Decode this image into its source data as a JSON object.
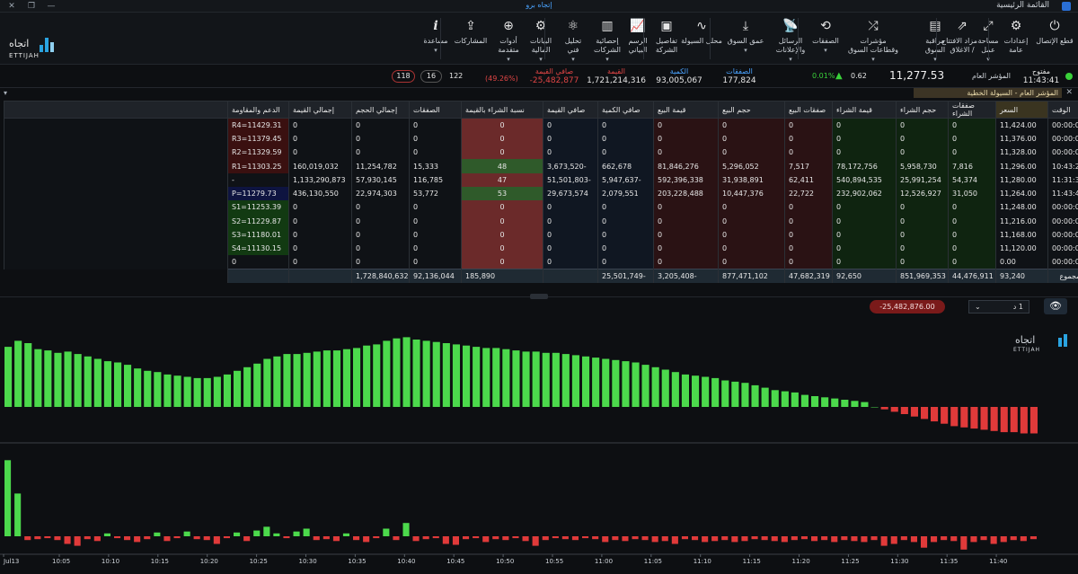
{
  "titlebar": {
    "title": "القائمة الرئيسية",
    "center": "إتجاه برو"
  },
  "ribbon": {
    "buttons": [
      {
        "label": "قطع الإتصال",
        "icon": "disconnect-icon",
        "glyph": "⏻"
      },
      {
        "label": "إعدادات",
        "label2": "عامة",
        "icon": "settings-icon",
        "glyph": "⚙"
      },
      {
        "label": "مساحة",
        "label2": "عمل",
        "dd": "▾",
        "icon": "workspace-icon",
        "glyph": "⤢"
      },
      {
        "label": "مزاد الافتتاح",
        "label2": "/ الاغلاق",
        "icon": "auction-icon",
        "glyph": "⇗"
      },
      {
        "label": "مراقبة",
        "label2": "السوق",
        "dd": "▾",
        "icon": "market-watch-icon",
        "glyph": "▤"
      },
      {
        "label": "مؤشرات",
        "label2": "وقطاعات السوق",
        "dd": "▾",
        "icon": "indices-icon",
        "glyph": "⤮"
      },
      {
        "label": "الصفقات",
        "dd": "▾",
        "icon": "trades-icon",
        "glyph": "⟲"
      },
      {
        "label": "الرسائل",
        "label2": "والإعلانات",
        "dd": "▾",
        "icon": "news-icon",
        "glyph": "📡"
      },
      {
        "label": "عمق السوق",
        "dd": "▾",
        "icon": "market-depth-icon",
        "glyph": "⤓"
      },
      {
        "label": "محلل السيولة",
        "icon": "liquidity-icon",
        "glyph": "∿"
      },
      {
        "label": "تفاصيل",
        "label2": "الشركة",
        "icon": "company-icon",
        "glyph": "▣"
      },
      {
        "label": "الرسم",
        "label2": "البياني",
        "icon": "chart-icon",
        "glyph": "📈"
      },
      {
        "label": "إحصائية",
        "label2": "الشركات",
        "dd": "▾",
        "icon": "stats-icon",
        "glyph": "▥"
      },
      {
        "label": "تحليل",
        "label2": "فني",
        "dd": "▾",
        "icon": "technical-icon",
        "glyph": "⚛"
      },
      {
        "label": "البيانات",
        "label2": "المالية",
        "dd": "▾",
        "icon": "financials-icon",
        "glyph": "⚙"
      },
      {
        "label": "أدوات",
        "label2": "متقدمة",
        "dd": "▾",
        "icon": "advanced-tools-icon",
        "glyph": "⊕"
      },
      {
        "label": "المشاركات",
        "icon": "share-icon",
        "glyph": "⇪"
      },
      {
        "label": "مساعدة",
        "dd": "▾",
        "icon": "help-icon",
        "glyph": "i"
      }
    ]
  },
  "logo": {
    "ar": "اتجاه",
    "en": "ETTIJAH"
  },
  "info": {
    "status": "مفتوح",
    "time": "11:43:41",
    "index_label": "المؤشر العام",
    "index_value": "11,277.53",
    "change": "0.62",
    "change_pct": "0.01%",
    "trades_label": "الصفقات",
    "trades_value": "177,824",
    "volume_label": "الكمية",
    "volume_value": "93,005,067",
    "value_label": "القيمة",
    "value_value": "1,721,214,316",
    "net_label": "صافي القيمة",
    "net_value": "-25,482,877",
    "net_pct": "(49.26%)",
    "up": "122",
    "unch": "16",
    "down": "118"
  },
  "panel": {
    "title": "المؤشر العام - السيولة الخطية"
  },
  "table": {
    "headers": [
      "الوقت",
      "السعر",
      "صفقات الشراء",
      "حجم الشراء",
      "قيمة الشراء",
      "صفقات البيع",
      "حجم البيع",
      "قيمة البيع",
      "صافي الكمية",
      "صافي القيمة",
      "نسبة الشراء بالقيمة",
      "الصفقات",
      "إجمالي الحجم",
      "إجمالي القيمة",
      "الدعم والمقاومة"
    ],
    "rows": [
      [
        "00:00:00",
        "11,424.00",
        "0",
        "0",
        "0",
        "0",
        "0",
        "0",
        "0",
        "0",
        "0",
        "0",
        "0",
        "0",
        "R4=11429.31"
      ],
      [
        "00:00:00",
        "11,376.00",
        "0",
        "0",
        "0",
        "0",
        "0",
        "0",
        "0",
        "0",
        "0",
        "0",
        "0",
        "0",
        "R3=11379.45"
      ],
      [
        "00:00:00",
        "11,328.00",
        "0",
        "0",
        "0",
        "0",
        "0",
        "0",
        "0",
        "0",
        "0",
        "0",
        "0",
        "0",
        "R2=11329.59"
      ],
      [
        "10:43:22",
        "11,296.00",
        "7,816",
        "5,958,730",
        "78,172,756",
        "7,517",
        "5,296,052",
        "81,846,276",
        "662,678",
        "-3,673,520",
        "48",
        "15,333",
        "11,254,782",
        "160,019,032",
        "R1=11303.25"
      ],
      [
        "11:31:31",
        "11,280.00",
        "54,374",
        "25,991,254",
        "540,894,535",
        "62,411",
        "31,938,891",
        "592,396,338",
        "-5,947,637",
        "-51,501,803",
        "47",
        "116,785",
        "57,930,145",
        "1,133,290,873",
        "-"
      ],
      [
        "11:43:40",
        "11,264.00",
        "31,050",
        "12,526,927",
        "232,902,062",
        "22,722",
        "10,447,376",
        "203,228,488",
        "2,079,551",
        "29,673,574",
        "53",
        "53,772",
        "22,974,303",
        "436,130,550",
        "P=11279.73"
      ],
      [
        "00:00:00",
        "11,248.00",
        "0",
        "0",
        "0",
        "0",
        "0",
        "0",
        "0",
        "0",
        "0",
        "0",
        "0",
        "0",
        "S1=11253.39"
      ],
      [
        "00:00:00",
        "11,216.00",
        "0",
        "0",
        "0",
        "0",
        "0",
        "0",
        "0",
        "0",
        "0",
        "0",
        "0",
        "0",
        "S2=11229.87"
      ],
      [
        "00:00:00",
        "11,168.00",
        "0",
        "0",
        "0",
        "0",
        "0",
        "0",
        "0",
        "0",
        "0",
        "0",
        "0",
        "0",
        "S3=11180.01"
      ],
      [
        "00:00:00",
        "11,120.00",
        "0",
        "0",
        "0",
        "0",
        "0",
        "0",
        "0",
        "0",
        "0",
        "0",
        "0",
        "0",
        "S4=11130.15"
      ],
      [
        "00:00:00",
        "0.00",
        "0",
        "0",
        "0",
        "0",
        "0",
        "0",
        "0",
        "0",
        "0",
        "0",
        "0",
        "0",
        "0"
      ]
    ],
    "total": [
      "المجموع",
      "93,240",
      "44,476,911",
      "851,969,353",
      "92,650",
      "47,682,319",
      "877,471,102",
      "-3,205,408",
      "-25,501,749",
      "",
      "185,890",
      "92,136,044",
      "1,728,840,632",
      ""
    ]
  },
  "controls": {
    "net_value": "-25,482,876.00",
    "period": "1 د"
  },
  "colors": {
    "up": "#4cd94c",
    "down": "#e03a3a",
    "accent": "#2aa3e0"
  },
  "chart_data": [
    {
      "type": "bar",
      "x": [
        "10:00",
        "10:01",
        "10:02",
        "10:03",
        "10:04",
        "10:05",
        "10:06",
        "10:07",
        "10:08",
        "10:09",
        "10:10",
        "10:11",
        "10:12",
        "10:13",
        "10:14",
        "10:15",
        "10:16",
        "10:17",
        "10:18",
        "10:19",
        "10:20",
        "10:21",
        "10:22",
        "10:23",
        "10:24",
        "10:25",
        "10:26",
        "10:27",
        "10:28",
        "10:29",
        "10:30",
        "10:31",
        "10:32",
        "10:33",
        "10:34",
        "10:35",
        "10:36",
        "10:37",
        "10:38",
        "10:39",
        "10:40",
        "10:41",
        "10:42",
        "10:43",
        "10:44",
        "10:45",
        "10:46",
        "10:47",
        "10:48",
        "10:49",
        "10:50",
        "10:51",
        "10:52",
        "10:53",
        "10:54",
        "10:55",
        "10:56",
        "10:57",
        "10:58",
        "10:59",
        "11:00",
        "11:01",
        "11:02",
        "11:03",
        "11:04",
        "11:05",
        "11:06",
        "11:07",
        "11:08",
        "11:09",
        "11:10",
        "11:11",
        "11:12",
        "11:13",
        "11:14",
        "11:15",
        "11:16",
        "11:17",
        "11:18",
        "11:19",
        "11:20",
        "11:21",
        "11:22",
        "11:23",
        "11:24",
        "11:25",
        "11:26",
        "11:27",
        "11:28",
        "11:29",
        "11:30",
        "11:31",
        "11:32",
        "11:33",
        "11:34",
        "11:35",
        "11:36",
        "11:37",
        "11:38",
        "11:39",
        "11:40",
        "11:41",
        "11:42",
        "11:43"
      ],
      "series": [
        {
          "values": [
            50,
            55,
            53,
            48,
            47,
            45,
            46,
            44,
            42,
            40,
            38,
            37,
            35,
            32,
            30,
            29,
            27,
            26,
            25,
            24,
            24,
            25,
            27,
            30,
            33,
            36,
            40,
            42,
            44,
            44,
            45,
            46,
            47,
            47,
            48,
            49,
            51,
            52,
            55,
            57,
            58,
            56,
            55,
            54,
            53,
            52,
            51,
            50,
            49,
            49,
            48,
            47,
            46,
            46,
            45,
            45,
            44,
            43,
            42,
            41,
            40,
            39,
            38,
            37,
            35,
            33,
            31,
            29,
            27,
            26,
            25,
            24,
            22,
            21,
            20,
            18,
            16,
            14,
            13,
            12,
            10,
            9,
            8,
            7,
            6,
            5,
            4,
            0,
            -2,
            -4,
            -6,
            -8,
            -10,
            -12,
            -14,
            -16,
            -17,
            -18,
            -19,
            -20,
            -21,
            -21,
            -22,
            -22
          ]
        }
      ],
      "ylim": [
        -30,
        62
      ]
    },
    {
      "type": "bar",
      "x_ticks": [
        "Jul13",
        "10:05",
        "10:10",
        "10:15",
        "10:20",
        "10:25",
        "10:30",
        "10:35",
        "10:40",
        "10:45",
        "10:50",
        "10:55",
        "11:00",
        "11:05",
        "11:10",
        "11:15",
        "11:20",
        "11:25",
        "11:30",
        "11:35",
        "11:40"
      ],
      "series": [
        {
          "values": [
            80,
            45,
            -4,
            -3,
            -2,
            -4,
            -8,
            -10,
            -3,
            -5,
            3,
            -2,
            -4,
            -6,
            -3,
            4,
            -5,
            -2,
            5,
            -3,
            -4,
            -8,
            -2,
            4,
            -5,
            6,
            10,
            3,
            -2,
            5,
            8,
            -4,
            -3,
            -5,
            3,
            -4,
            -6,
            -2,
            8,
            -4,
            14,
            -5,
            -3,
            -2,
            -8,
            -9,
            -3,
            -2,
            -6,
            -3,
            -4,
            -2,
            -5,
            -10,
            -4,
            -2,
            -3,
            -4,
            -2,
            -3,
            -6,
            -4,
            -5,
            -3,
            -4,
            -6,
            -5,
            -8,
            -3,
            -4,
            -6,
            -5,
            -4,
            -6,
            -5,
            -3,
            -4,
            -5,
            -6,
            -4,
            -3,
            -5,
            -4,
            -6,
            -4,
            -5,
            -6,
            -4,
            -10,
            -8,
            -4,
            -6,
            -12,
            -6,
            -4,
            -5,
            -14,
            -6,
            -4,
            -8,
            -6,
            -4,
            -5,
            -3
          ]
        }
      ],
      "ylim": [
        -20,
        85
      ]
    }
  ]
}
